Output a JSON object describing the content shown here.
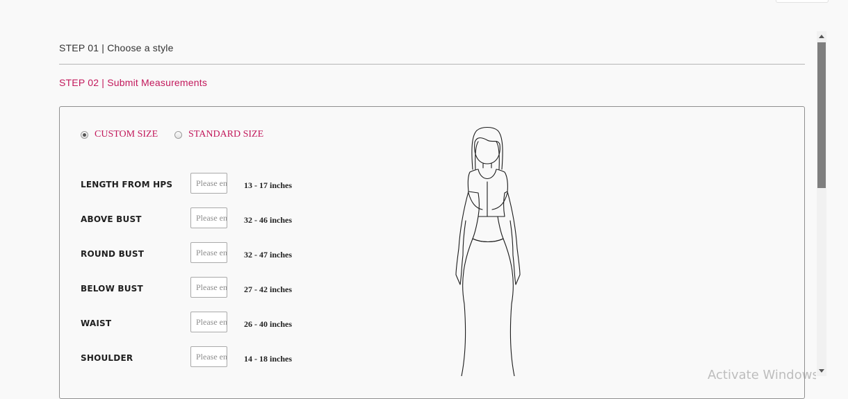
{
  "steps": {
    "step1": "STEP 01 | Choose a style",
    "step2": "STEP 02 | Submit Measurements"
  },
  "size_options": {
    "custom": "CUSTOM SIZE",
    "standard": "STANDARD SIZE",
    "selected": "custom"
  },
  "measurements": [
    {
      "label": "LENGTH FROM HPS",
      "placeholder": "Please enter",
      "range": "13 - 17 inches"
    },
    {
      "label": "ABOVE BUST",
      "placeholder": "Please enter",
      "range": "32 - 46 inches"
    },
    {
      "label": "ROUND BUST",
      "placeholder": "Please enter",
      "range": "32 - 47 inches"
    },
    {
      "label": "BELOW BUST",
      "placeholder": "Please enter",
      "range": "27 - 42 inches"
    },
    {
      "label": "WAIST",
      "placeholder": "Please enter",
      "range": "26 - 40 inches"
    },
    {
      "label": "SHOULDER",
      "placeholder": "Please enter",
      "range": "14 - 18 inches"
    }
  ],
  "watermark": "Activate Windows",
  "colors": {
    "accent": "#c2185b",
    "background": "#f9f9f9",
    "border": "#8f8f8f"
  },
  "icons": {
    "figure": "dress-figure-illustration",
    "scroll_up": "scroll-up-arrow-icon",
    "scroll_down": "scroll-down-arrow-icon"
  }
}
